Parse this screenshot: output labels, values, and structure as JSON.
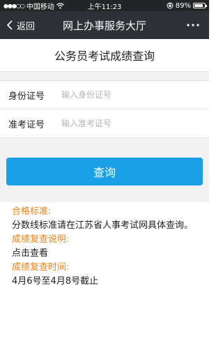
{
  "status_bar": {
    "carrier": "中国移动",
    "time": "上午11:23",
    "battery": "89%",
    "battery_level": 0.89
  },
  "nav": {
    "back_label": "返回",
    "title": "网上办事服务大厅",
    "more_label": "···"
  },
  "page": {
    "title": "公务员考试成绩查询"
  },
  "form": {
    "id_label": "身份证号",
    "id_placeholder": "输入身份证号",
    "ticket_label": "准考证号",
    "ticket_placeholder": "输入准考证号"
  },
  "query_button": "查询",
  "info": {
    "standard_heading": "合格标准:",
    "standard_text": "分数线标准请在江苏省人事考试网具体查询。",
    "review_heading": "成绩复查说明:",
    "review_text": "点击查看",
    "review_time_heading": "成绩复查时间:",
    "review_time_text": "4月6号至4月8号截止"
  },
  "colors": {
    "accent": "#1aa0e6",
    "highlight": "#f08519",
    "navbar": "#2e3135"
  }
}
